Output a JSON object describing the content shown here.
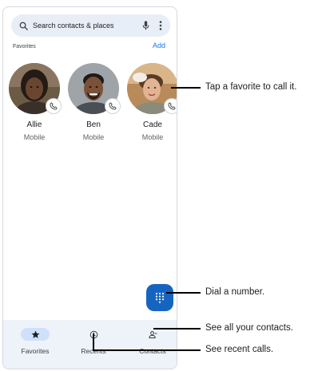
{
  "search": {
    "placeholder": "Search contacts & places"
  },
  "favorites": {
    "heading": "Favorites",
    "add_label": "Add",
    "items": [
      {
        "name": "Allie",
        "type": "Mobile"
      },
      {
        "name": "Ben",
        "type": "Mobile"
      },
      {
        "name": "Cade",
        "type": "Mobile"
      }
    ]
  },
  "nav": {
    "items": [
      {
        "label": "Favorites",
        "icon": "star-icon",
        "active": true
      },
      {
        "label": "Recents",
        "icon": "clock-icon",
        "active": false
      },
      {
        "label": "Contacts",
        "icon": "contacts-icon",
        "active": false
      }
    ]
  },
  "callouts": {
    "favorite": "Tap a favorite to call it.",
    "dial": "Dial a number.",
    "contacts": "See all your contacts.",
    "recents": "See recent calls."
  },
  "colors": {
    "accent": "#1a73e8",
    "fab": "#1565c0",
    "search_bg": "#e8eef7",
    "nav_bg": "#eef2f9",
    "active_pill": "#cfe0fb"
  }
}
